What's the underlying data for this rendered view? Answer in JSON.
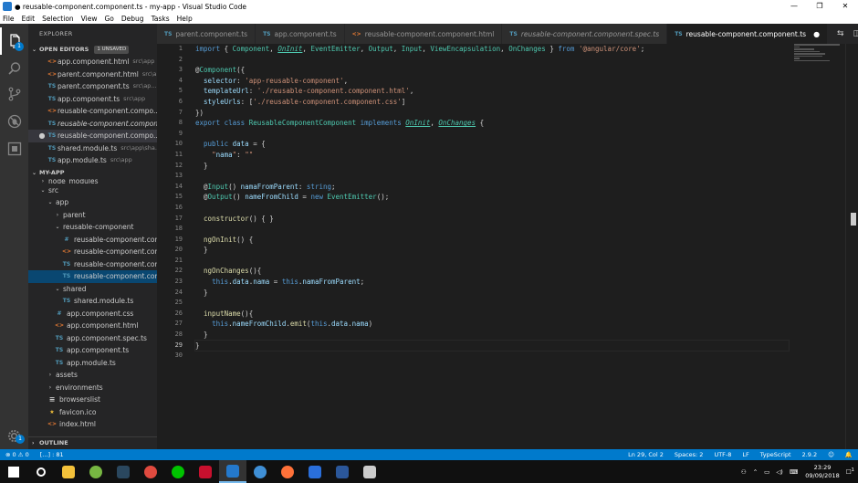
{
  "window": {
    "title": "● reusable-component.component.ts - my-app - Visual Studio Code",
    "controls": [
      "—",
      "❐",
      "✕"
    ]
  },
  "menu": [
    "File",
    "Edit",
    "Selection",
    "View",
    "Go",
    "Debug",
    "Tasks",
    "Help"
  ],
  "activity": {
    "explorer_badge": "1"
  },
  "sidebar": {
    "title": "EXPLORER",
    "open_editors": {
      "label": "OPEN EDITORS",
      "badge": "1 UNSAVED",
      "items": [
        {
          "icon": "<>",
          "type": "html",
          "name": "app.component.html",
          "path": "src\\app"
        },
        {
          "icon": "<>",
          "type": "html",
          "name": "parent.component.html",
          "path": "src\\ap..."
        },
        {
          "icon": "TS",
          "type": "ts",
          "name": "parent.component.ts",
          "path": "src\\ap..."
        },
        {
          "icon": "TS",
          "type": "ts",
          "name": "app.component.ts",
          "path": "src\\app"
        },
        {
          "icon": "<>",
          "type": "html",
          "name": "reusable-component.compo...",
          "path": ""
        },
        {
          "icon": "TS",
          "type": "ts",
          "name": "reusable-component.compon...",
          "path": "",
          "italic": true
        },
        {
          "icon": "TS",
          "type": "ts",
          "name": "reusable-component.compo...",
          "path": "",
          "dirty": true
        },
        {
          "icon": "TS",
          "type": "ts",
          "name": "shared.module.ts",
          "path": "src\\app\\sha..."
        },
        {
          "icon": "TS",
          "type": "ts",
          "name": "app.module.ts",
          "path": "src\\app"
        }
      ]
    },
    "project": {
      "label": "MY-APP",
      "items": [
        {
          "caret": "›",
          "name": "node_modules",
          "indent": 1
        },
        {
          "caret": "⌄",
          "name": "src",
          "indent": 1
        },
        {
          "caret": "⌄",
          "name": "app",
          "indent": 2
        },
        {
          "caret": "›",
          "name": "parent",
          "indent": 3
        },
        {
          "caret": "⌄",
          "name": "reusable-component",
          "indent": 3
        },
        {
          "icon": "#",
          "type": "css",
          "name": "reusable-component.comp...",
          "indent": 4
        },
        {
          "icon": "<>",
          "type": "html",
          "name": "reusable-component.comp...",
          "indent": 4
        },
        {
          "icon": "TS",
          "type": "ts",
          "name": "reusable-component.comp...",
          "indent": 4
        },
        {
          "icon": "TS",
          "type": "ts",
          "name": "reusable-component.comp...",
          "indent": 4,
          "selected": true
        },
        {
          "caret": "⌄",
          "name": "shared",
          "indent": 3
        },
        {
          "icon": "TS",
          "type": "ts",
          "name": "shared.module.ts",
          "indent": 4
        },
        {
          "icon": "#",
          "type": "css",
          "name": "app.component.css",
          "indent": 3
        },
        {
          "icon": "<>",
          "type": "html",
          "name": "app.component.html",
          "indent": 3
        },
        {
          "icon": "TS",
          "type": "ts",
          "name": "app.component.spec.ts",
          "indent": 3
        },
        {
          "icon": "TS",
          "type": "ts",
          "name": "app.component.ts",
          "indent": 3
        },
        {
          "icon": "TS",
          "type": "ts",
          "name": "app.module.ts",
          "indent": 3
        },
        {
          "caret": "›",
          "name": "assets",
          "indent": 2
        },
        {
          "caret": "›",
          "name": "environments",
          "indent": 2
        },
        {
          "icon": "≡",
          "type": "dot",
          "name": "browserslist",
          "indent": 2
        },
        {
          "icon": "★",
          "type": "html",
          "name": "favicon.ico",
          "indent": 2
        },
        {
          "icon": "<>",
          "type": "html",
          "name": "index.html",
          "indent": 2
        }
      ]
    },
    "outline_label": "OUTLINE"
  },
  "tabs": [
    {
      "icon": "TS",
      "type": "ts",
      "label": "parent.component.ts"
    },
    {
      "icon": "TS",
      "type": "ts",
      "label": "app.component.ts"
    },
    {
      "icon": "<>",
      "type": "html",
      "label": "reusable-component.component.html"
    },
    {
      "icon": "TS",
      "type": "ts",
      "label": "reusable-component.component.spec.ts",
      "italic": true
    },
    {
      "icon": "TS",
      "type": "ts",
      "label": "reusable-component.component.ts",
      "active": true,
      "dirty": "●"
    }
  ],
  "editor": {
    "current_line": 29,
    "lines": [
      "import { Component, OnInit, EventEmitter, Output, Input, ViewEncapsulation, OnChanges } from '@angular/core';",
      "",
      "@Component({",
      "  selector: 'app-reusable-component',",
      "  templateUrl: './reusable-component.component.html',",
      "  styleUrls: ['./reusable-component.component.css']",
      "})",
      "export class ReusableComponentComponent implements OnInit, OnChanges {",
      "",
      "  public data = {",
      "    \"nama\": \"\"",
      "  }",
      "",
      "  @Input() namaFromParent: string;",
      "  @Output() nameFromChild = new EventEmitter();",
      "",
      "  constructor() { }",
      "",
      "  ngOnInit() {",
      "  }",
      "",
      "  ngOnChanges(){",
      "    this.data.nama = this.namaFromParent;",
      "  }",
      "",
      "  inputName(){",
      "    this.nameFromChild.emit(this.data.nama)",
      "  }",
      "}",
      ""
    ]
  },
  "status": {
    "errors": "⊗ 0",
    "warnings": "⚠ 0",
    "selection": "[...] : 81",
    "position": "Ln 29, Col 2",
    "spaces": "Spaces: 2",
    "encoding": "UTF-8",
    "eol": "LF",
    "language": "TypeScript",
    "version": "2.9.2",
    "smiley": "☺",
    "bell": "🔔"
  },
  "taskbar": {
    "time": "23:29",
    "date": "09/09/2018",
    "notifications": "1",
    "apps": [
      {
        "name": "windows-start",
        "color": "#ffffff"
      },
      {
        "name": "search",
        "color": "#ffffff"
      },
      {
        "name": "file-explorer",
        "color": "#f3c13a"
      },
      {
        "name": "bittorrent",
        "color": "#77b742"
      },
      {
        "name": "steam",
        "color": "#2a475e"
      },
      {
        "name": "chrome",
        "color": "#e04a3f"
      },
      {
        "name": "line",
        "color": "#00c300"
      },
      {
        "name": "opera-mail",
        "color": "#c8102e"
      },
      {
        "name": "vscode",
        "color": "#2479cc"
      },
      {
        "name": "photos",
        "color": "#3f8fd6"
      },
      {
        "name": "firefox",
        "color": "#ff7139"
      },
      {
        "name": "maps",
        "color": "#2a6fdb"
      },
      {
        "name": "word",
        "color": "#2b579a"
      },
      {
        "name": "terminal",
        "color": "#cccccc"
      }
    ]
  }
}
